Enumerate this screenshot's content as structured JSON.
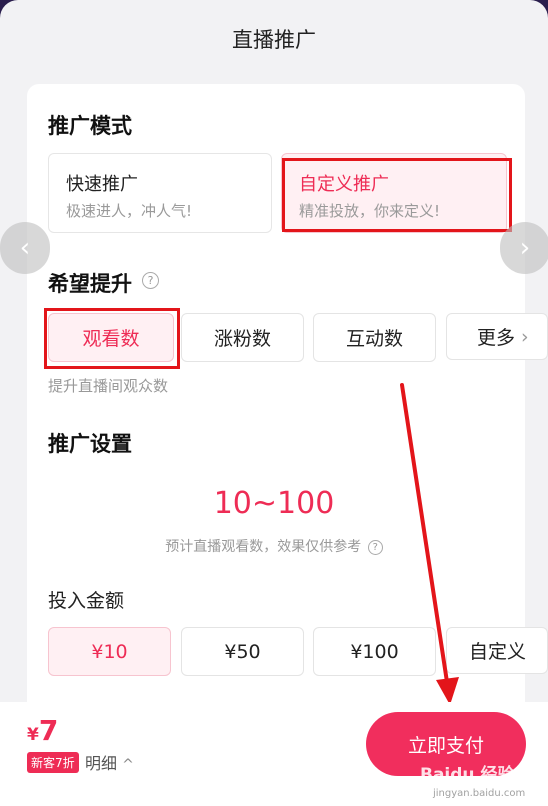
{
  "header": {
    "title": "直播推广"
  },
  "promo_mode": {
    "title": "推广模式",
    "options": [
      {
        "title": "快速推广",
        "subtitle": "极速进人，冲人气!"
      },
      {
        "title": "自定义推广",
        "subtitle": "精准投放，你来定义!"
      }
    ]
  },
  "nav": {
    "prev_symbol": "‹",
    "next_symbol": "›"
  },
  "goal": {
    "title": "希望提升",
    "help_symbol": "?",
    "options": [
      "观看数",
      "涨粉数",
      "互动数",
      "更多"
    ],
    "more_chevron": "›",
    "hint": "提升直播间观众数"
  },
  "settings": {
    "title": "推广设置",
    "range": "10~100",
    "note": "预计直播观看数，效果仅供参考",
    "help_symbol": "?",
    "amount_label": "投入金额",
    "amount_options": [
      "¥10",
      "¥50",
      "¥100",
      "自定义"
    ]
  },
  "footer": {
    "currency": "¥",
    "price": "7",
    "badge": "新客7折",
    "detail": "明细",
    "detail_chevron": "^",
    "pay_label": "立即支付"
  },
  "watermark": {
    "text": "Baidu 经验",
    "sub": "jingyan.baidu.com"
  },
  "colors": {
    "accent": "#ee2c55",
    "highlight_border": "#e3151a",
    "annotation_arrow": "#e3151a"
  }
}
